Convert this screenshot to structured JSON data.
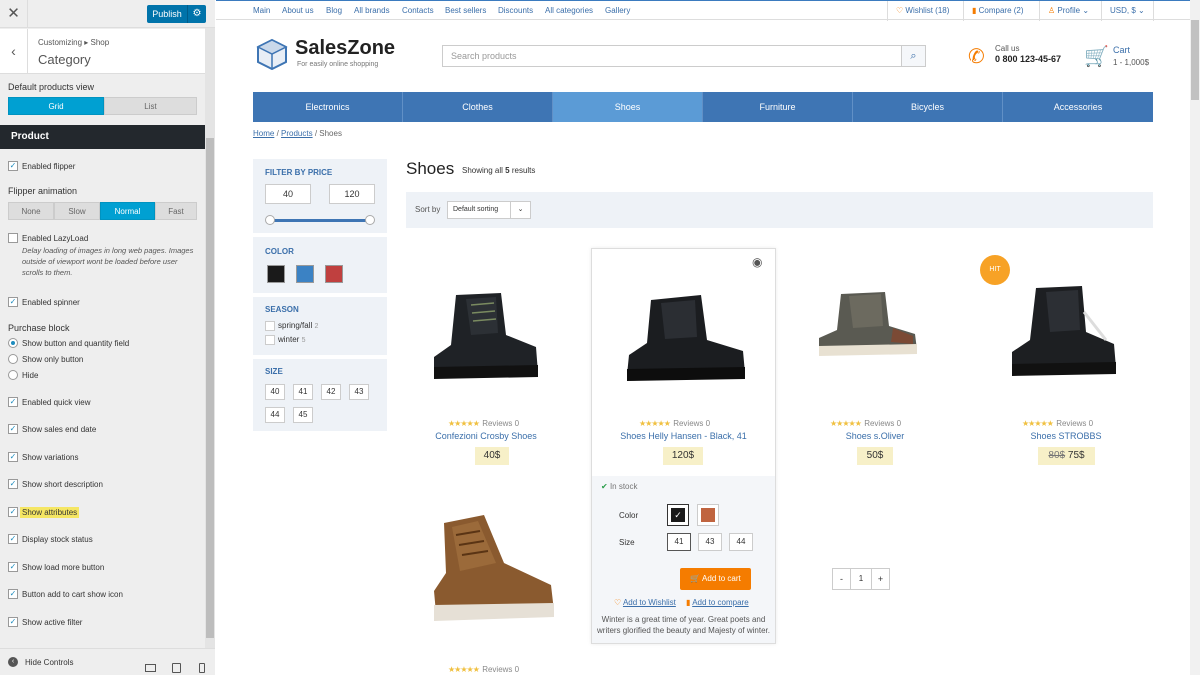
{
  "customizer": {
    "publish_label": "Publish",
    "breadcrumb": "Customizing ▸ Shop",
    "title": "Category",
    "default_view_label": "Default products view",
    "view_options": [
      "Grid",
      "List"
    ],
    "section_title": "Product",
    "enabled_flipper": "Enabled flipper",
    "flipper_anim_label": "Flipper animation",
    "flipper_options": [
      "None",
      "Slow",
      "Normal",
      "Fast"
    ],
    "lazyload_label": "Enabled LazyLoad",
    "lazyload_desc": "Delay loading of images in long web pages. Images outside of viewport wont be loaded before user scrolls to them.",
    "spinner_label": "Enabled spinner",
    "purchase_label": "Purchase block",
    "purchase_options": [
      "Show button and quantity field",
      "Show only button",
      "Hide"
    ],
    "checks": [
      "Enabled quick view",
      "Show sales end date",
      "Show variations",
      "Show short description",
      "Show attributes",
      "Display stock status",
      "Show load more button",
      "Button add to cart show icon",
      "Show active filter"
    ],
    "hide_controls": "Hide Controls"
  },
  "topbar": {
    "links": [
      "Main",
      "About us",
      "Blog",
      "All brands",
      "Contacts",
      "Best sellers",
      "Discounts",
      "All categories",
      "Gallery"
    ],
    "wishlist": "Wishlist (18)",
    "compare": "Compare (2)",
    "profile": "Profile",
    "currency": "USD, $"
  },
  "header": {
    "logo": "SalesZone",
    "tagline": "For easily online shopping",
    "search_placeholder": "Search products",
    "call_label": "Call us",
    "phone": "0 800 123-45-67",
    "cart_label": "Cart",
    "cart_value": "1 - 1,000$"
  },
  "nav": [
    "Electronics",
    "Clothes",
    "Shoes",
    "Furniture",
    "Bicycles",
    "Accessories"
  ],
  "breadcrumb": {
    "home": "Home",
    "products": "Products",
    "current": "Shoes"
  },
  "filters": {
    "price_title": "FILTER BY PRICE",
    "price_min": "40",
    "price_max": "120",
    "color_title": "COLOR",
    "colors": [
      "#1a1a1a",
      "#3b82c4",
      "#c0403f"
    ],
    "season_title": "SEASON",
    "seasons": [
      {
        "label": "spring/fall",
        "count": "2"
      },
      {
        "label": "winter",
        "count": "5"
      }
    ],
    "size_title": "SIZE",
    "sizes": [
      "40",
      "41",
      "42",
      "43",
      "44",
      "45"
    ]
  },
  "main": {
    "title": "Shoes",
    "showing_pre": "Showing all",
    "showing_num": "5",
    "showing_post": "results",
    "sort_label": "Sort by",
    "sort_value": "Default sorting"
  },
  "products": [
    {
      "name": "Confezioni Crosby Shoes",
      "price": "40$",
      "reviews": "Reviews 0"
    },
    {
      "name": "Shoes Helly Hansen - Black, 41",
      "price": "120$",
      "reviews": "Reviews 0"
    },
    {
      "name": "Shoes s.Oliver",
      "price": "50$",
      "reviews": "Reviews 0"
    },
    {
      "name": "Shoes STROBBS",
      "old_price": "80$",
      "price": "75$",
      "reviews": "Reviews 0",
      "badge": "HIT"
    },
    {
      "reviews": "Reviews 0"
    }
  ],
  "quickview": {
    "stock": "In stock",
    "color_label": "Color",
    "size_label": "Size",
    "sizes": [
      "41",
      "43",
      "44"
    ],
    "qty": "1",
    "add_to_cart": "Add to cart",
    "wishlist": "Add to Wishlist",
    "compare": "Add to compare",
    "description": "Winter is a great time of year. Great poets and writers glorified the beauty and Majesty of winter."
  }
}
